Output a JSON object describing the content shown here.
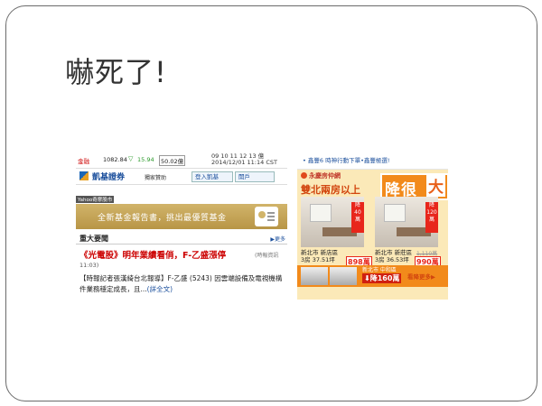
{
  "slide": {
    "title": "嚇死了!"
  },
  "left_screenshot": {
    "ticker": {
      "label": "金融",
      "index": "1082.84",
      "change": "15.94",
      "volume": "50.02億",
      "time_line1": "09 10 11 12 13 億",
      "time_line2": "2014/12/01 11:14 CST"
    },
    "broker": {
      "name": "凱基證券",
      "sponsor": "獨家贊助",
      "button1": "登入凱基",
      "button2": "開戶"
    },
    "section_label": "Yahoo奇摩股市",
    "banner_text": "全新基金報告書，挑出最優質基金",
    "news": {
      "header": "重大要聞",
      "more": "▶更多",
      "headline": "《光電股》明年業績看俏，F-乙盛漲停",
      "source": "(時報資訊",
      "time": "11:03)",
      "summary": "【時報記者張漢綺台北報導】F-乙盛 (5243) 因雲端設備及電視機構件業務穩定成長，且...",
      "full_link": "(詳全文)"
    }
  },
  "right_screenshot": {
    "top_link": "• 鑫豐6 時神行動下單•鑫豐極選!",
    "ad": {
      "brand": "永慶房仲網",
      "headline": "雙北兩房以上",
      "big_text": "降很",
      "big_badge": "大",
      "drop1": "降 40 萬",
      "drop2": "降 120 萬",
      "caption1_line1": "新北市 新店區",
      "caption1_line2": "3房 37.51坪",
      "caption2_line1": "新北市 新莊區",
      "caption2_line2": "3房 36.53坪",
      "price1": "898萬",
      "price2": "990萬",
      "old2": "1,110萬",
      "bottom_location": "新北市 中和區",
      "bottom_cut": "⬇降160萬",
      "bottom_more": "看降更多▶"
    }
  }
}
